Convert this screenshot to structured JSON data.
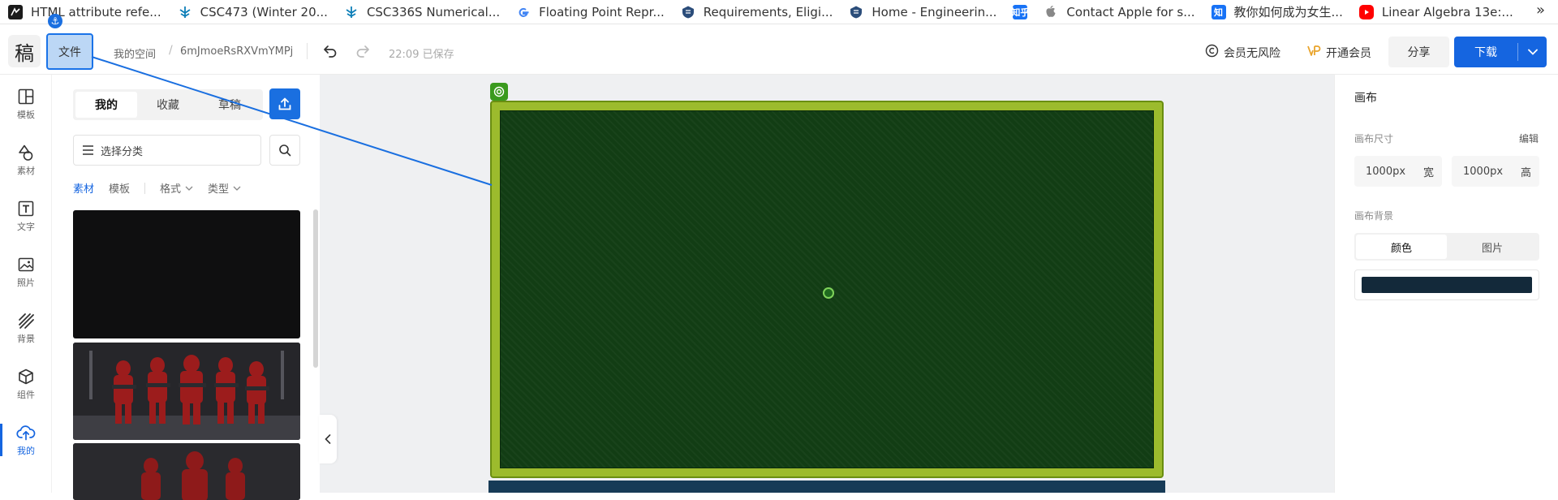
{
  "bookmarks": [
    {
      "label": "HTML attribute refe...",
      "icon": "mdn-icon",
      "color": "#1b1b1b"
    },
    {
      "label": "CSC473 (Winter 20...",
      "icon": "uoft-tree-icon",
      "color": "#0e7fb8"
    },
    {
      "label": "CSC336S Numerical...",
      "icon": "uoft-tree-icon",
      "color": "#0e7fb8"
    },
    {
      "label": "Floating Point Repr...",
      "icon": "google-icon",
      "color": "#4285f4"
    },
    {
      "label": "Requirements, Eligi...",
      "icon": "uoft-crest-icon",
      "color": "#2b4d7a"
    },
    {
      "label": "Home - Engineerin...",
      "icon": "uoft-crest-icon",
      "color": "#2b4d7a"
    },
    {
      "label": "",
      "icon": "zhihu-small-icon",
      "color": "#1772f6",
      "glyph": "知乎"
    },
    {
      "label": "Contact Apple for s...",
      "icon": "apple-icon",
      "color": "#777777"
    },
    {
      "label": "教你如何成为女生...",
      "icon": "zhihu-icon",
      "color": "#1772f6",
      "glyph": "知"
    },
    {
      "label": "Linear Algebra 13e:...",
      "icon": "youtube-icon",
      "color": "#ff0000"
    }
  ],
  "bookmarks_more": "»",
  "toolbar": {
    "logo": "稿",
    "file_label": "文件",
    "anchor_glyph": "⚓",
    "breadcrumb_space": "我的空间",
    "breadcrumb_sep": "/",
    "breadcrumb_doc": "6mJmoeRsRXVmYMPj",
    "saved_status": "22:09 已保存",
    "member_risk_free": "会员无风险",
    "open_member": "开通会员",
    "share": "分享",
    "download": "下载"
  },
  "rail": [
    {
      "label": "模板",
      "icon": "template-icon"
    },
    {
      "label": "素材",
      "icon": "shapes-icon"
    },
    {
      "label": "文字",
      "icon": "text-icon"
    },
    {
      "label": "照片",
      "icon": "photo-icon"
    },
    {
      "label": "背景",
      "icon": "background-icon"
    },
    {
      "label": "组件",
      "icon": "component-icon"
    },
    {
      "label": "我的",
      "icon": "cloud-upload-icon",
      "active": true
    }
  ],
  "panel": {
    "tabs": [
      {
        "label": "我的",
        "active": true
      },
      {
        "label": "收藏"
      },
      {
        "label": "草稿"
      }
    ],
    "category_placeholder": "选择分类",
    "filters": [
      {
        "label": "素材",
        "active": true
      },
      {
        "label": "模板"
      },
      {
        "label": "格式",
        "dropdown": true
      },
      {
        "label": "类型",
        "dropdown": true
      }
    ]
  },
  "properties": {
    "title": "画布",
    "size_label": "画布尺寸",
    "edit": "编辑",
    "width_value": "1000px",
    "width_unit": "宽",
    "height_value": "1000px",
    "height_unit": "高",
    "bg_label": "画布背景",
    "bg_tabs": [
      {
        "label": "颜色",
        "active": true
      },
      {
        "label": "图片"
      }
    ],
    "bg_color": "#13293a"
  },
  "colors": {
    "accent": "#1565e0",
    "artboard_frame": "#9cbb2d",
    "artboard_fill": "#123d14"
  }
}
